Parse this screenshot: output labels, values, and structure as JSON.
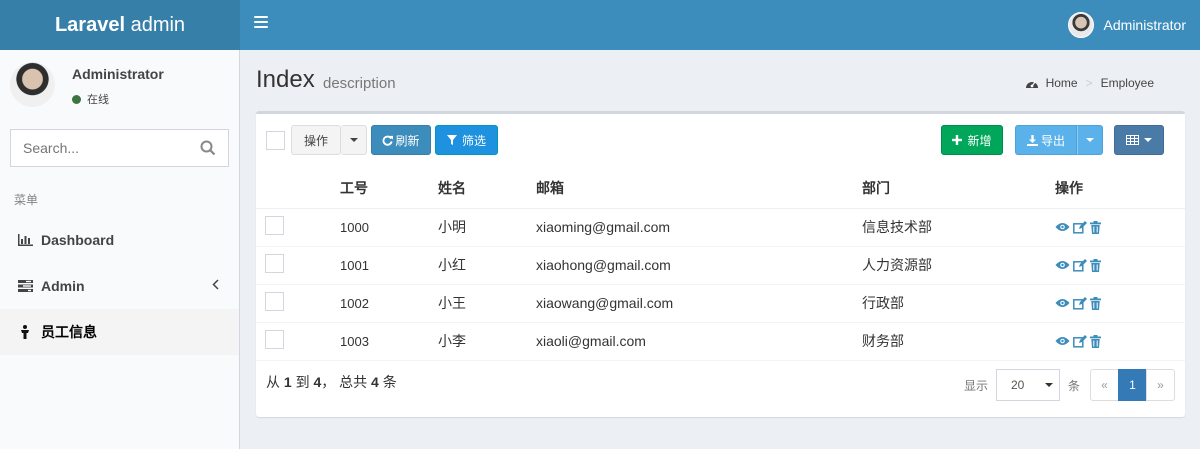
{
  "header": {
    "logo_bold": "Laravel",
    "logo_rest": " admin",
    "user_name": "Administrator"
  },
  "sidebar": {
    "user_name": "Administrator",
    "status": "在线",
    "search_placeholder": "Search...",
    "menu_header": "菜单",
    "items": [
      {
        "label": "Dashboard",
        "icon": "bar-chart-icon"
      },
      {
        "label": "Admin",
        "icon": "tasks-icon"
      },
      {
        "label": "员工信息",
        "icon": "user-icon"
      }
    ]
  },
  "page": {
    "title": "Index",
    "description": "description",
    "breadcrumb": [
      "Home",
      "Employee"
    ]
  },
  "toolbar": {
    "action_label": "操作",
    "refresh_label": "刷新",
    "filter_label": "筛选",
    "create_label": "新增",
    "export_label": "导出"
  },
  "table": {
    "columns": [
      "工号",
      "姓名",
      "邮箱",
      "部门",
      "操作"
    ],
    "rows": [
      {
        "id": "1000",
        "name": "小明",
        "email": "xiaoming@gmail.com",
        "dept": "信息技术部"
      },
      {
        "id": "1001",
        "name": "小红",
        "email": "xiaohong@gmail.com",
        "dept": "人力资源部"
      },
      {
        "id": "1002",
        "name": "小王",
        "email": "xiaowang@gmail.com",
        "dept": "行政部"
      },
      {
        "id": "1003",
        "name": "小李",
        "email": "xiaoli@gmail.com",
        "dept": "财务部"
      }
    ]
  },
  "footer": {
    "from_text": "从",
    "from_val": "1",
    "to_text": " 到 ",
    "to_val": "4",
    "total_text": "， 总共 ",
    "total_val": "4",
    "unit": " 条",
    "show_label": "显示",
    "per_page": "20",
    "per_page_unit": "条",
    "prev": "«",
    "current_page": "1",
    "next": "»"
  },
  "colors": {
    "header": "#3c8dbc",
    "logo_bg": "#367fa9",
    "success": "#00a65a",
    "primary": "#337ab7"
  }
}
